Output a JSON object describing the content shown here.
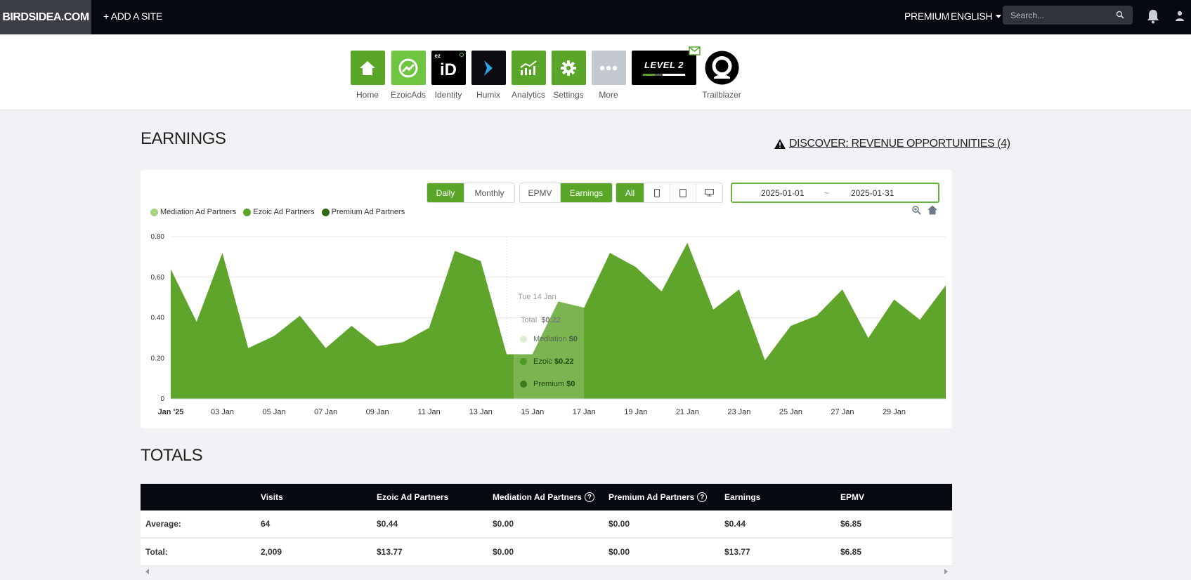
{
  "topbar": {
    "brand": "BIRDSIDEA.COM",
    "add_site": "+ ADD A SITE",
    "premium": "PREMIUM",
    "language": "ENGLISH",
    "search_placeholder": "Search..."
  },
  "apps": [
    {
      "label": "Home",
      "icon": "home-icon"
    },
    {
      "label": "EzoicAds",
      "icon": "ezoicads-icon"
    },
    {
      "label": "Identity",
      "icon": "identity-icon",
      "tile_text": "iD",
      "tile_sub": "ez"
    },
    {
      "label": "Humix",
      "icon": "humix-icon"
    },
    {
      "label": "Analytics",
      "icon": "analytics-icon"
    },
    {
      "label": "Settings",
      "icon": "gear-icon"
    },
    {
      "label": "More",
      "icon": "more-icon"
    },
    {
      "label": "",
      "icon": "level-badge-icon",
      "tile_text": "LEVEL 2"
    },
    {
      "label": "Trailblazer",
      "icon": "trailblazer-icon"
    }
  ],
  "earnings": {
    "title": "EARNINGS",
    "discover": "DISCOVER: REVENUE OPPORTUNITIES (4)",
    "period_buttons": [
      "Daily",
      "Monthly"
    ],
    "metric_buttons": [
      "EPMV",
      "Earnings"
    ],
    "device_buttons": [
      "All"
    ],
    "date_from": "2025-01-01",
    "date_sep": "~",
    "date_to": "2025-01-31"
  },
  "tooltip": {
    "date": "Tue 14 Jan",
    "total_label": "Total",
    "total_value": "$0.22",
    "rows": [
      {
        "label": "Mediation",
        "value": "$0"
      },
      {
        "label": "Ezoic",
        "value": "$0.22"
      },
      {
        "label": "Premium",
        "value": "$0"
      }
    ]
  },
  "colors": {
    "accent": "#5aa629",
    "mediation": "#a5d37e",
    "ezoic": "#5aa629",
    "premium": "#2f6b12",
    "area": "#5fa52b"
  },
  "chart_data": {
    "type": "area",
    "legend": [
      "Mediation Ad Partners",
      "Ezoic Ad Partners",
      "Premium Ad Partners"
    ],
    "x": [
      "Jan 1",
      "Jan 2",
      "Jan 3",
      "Jan 4",
      "Jan 5",
      "Jan 6",
      "Jan 7",
      "Jan 8",
      "Jan 9",
      "Jan 10",
      "Jan 11",
      "Jan 12",
      "Jan 13",
      "Jan 14",
      "Jan 15",
      "Jan 16",
      "Jan 17",
      "Jan 18",
      "Jan 19",
      "Jan 20",
      "Jan 21",
      "Jan 22",
      "Jan 23",
      "Jan 24",
      "Jan 25",
      "Jan 26",
      "Jan 27",
      "Jan 28",
      "Jan 29",
      "Jan 30",
      "Jan 31"
    ],
    "series": [
      {
        "name": "Ezoic Ad Partners",
        "values": [
          0.64,
          0.38,
          0.72,
          0.25,
          0.31,
          0.41,
          0.25,
          0.36,
          0.26,
          0.28,
          0.35,
          0.73,
          0.68,
          0.22,
          0.22,
          0.48,
          0.45,
          0.72,
          0.65,
          0.53,
          0.77,
          0.44,
          0.54,
          0.19,
          0.36,
          0.41,
          0.54,
          0.3,
          0.49,
          0.39,
          0.56
        ]
      },
      {
        "name": "Mediation Ad Partners",
        "values": [
          0,
          0,
          0,
          0,
          0,
          0,
          0,
          0,
          0,
          0,
          0,
          0,
          0,
          0,
          0,
          0,
          0,
          0,
          0,
          0,
          0,
          0,
          0,
          0,
          0,
          0,
          0,
          0,
          0,
          0,
          0
        ]
      },
      {
        "name": "Premium Ad Partners",
        "values": [
          0,
          0,
          0,
          0,
          0,
          0,
          0,
          0,
          0,
          0,
          0,
          0,
          0,
          0,
          0,
          0,
          0,
          0,
          0,
          0,
          0,
          0,
          0,
          0,
          0,
          0,
          0,
          0,
          0,
          0,
          0
        ]
      }
    ],
    "x_tick_labels": [
      "Jan '25",
      "03 Jan",
      "05 Jan",
      "07 Jan",
      "09 Jan",
      "11 Jan",
      "13 Jan",
      "15 Jan",
      "17 Jan",
      "19 Jan",
      "21 Jan",
      "23 Jan",
      "25 Jan",
      "27 Jan",
      "29 Jan"
    ],
    "y_tick_labels": [
      "0",
      "0.20",
      "0.40",
      "0.60",
      "0.80"
    ],
    "ylim": [
      0,
      0.8
    ],
    "grid": true,
    "legend_position": "top-left"
  },
  "totals": {
    "title": "TOTALS",
    "headers": [
      "",
      "Visits",
      "Ezoic Ad Partners",
      "Mediation Ad Partners",
      "Premium Ad Partners",
      "Earnings",
      "EPMV"
    ],
    "rows": [
      [
        "Average:",
        "64",
        "$0.44",
        "$0.00",
        "$0.00",
        "$0.44",
        "$6.85"
      ],
      [
        "Total:",
        "2,009",
        "$13.77",
        "$0.00",
        "$0.00",
        "$13.77",
        "$6.85"
      ]
    ]
  }
}
